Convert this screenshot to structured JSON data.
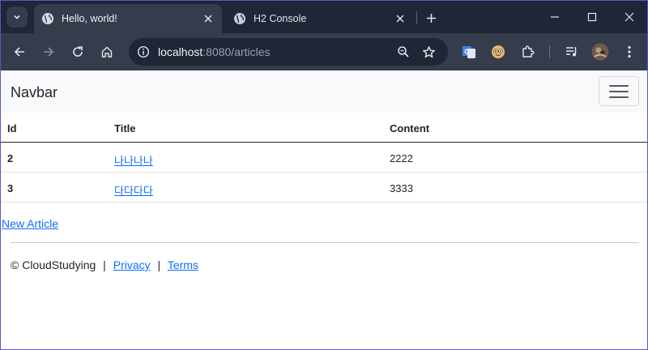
{
  "browser": {
    "tabs": [
      {
        "title": "Hello, world!",
        "active": true
      },
      {
        "title": "H2 Console",
        "active": false
      }
    ],
    "url": {
      "host": "localhost",
      "rest": ":8080/articles"
    },
    "colors": {
      "chrome_dark": "#1f2635",
      "chrome_light": "#353c4c",
      "icon": "#e3e6ec"
    }
  },
  "navbar": {
    "brand": "Navbar"
  },
  "table": {
    "headers": {
      "id": "Id",
      "title": "Title",
      "content": "Content"
    },
    "rows": [
      {
        "id": "2",
        "title": "나나나나",
        "content": "2222"
      },
      {
        "id": "3",
        "title": "다다다다",
        "content": "3333"
      }
    ]
  },
  "links": {
    "new_article": "New Article"
  },
  "footer": {
    "copyright": "© CloudStudying",
    "separator": "|",
    "privacy": "Privacy",
    "terms": "Terms"
  },
  "colors": {
    "link": "#0d6efd",
    "navbar_bg": "#f8f9fa",
    "text": "#212529"
  }
}
